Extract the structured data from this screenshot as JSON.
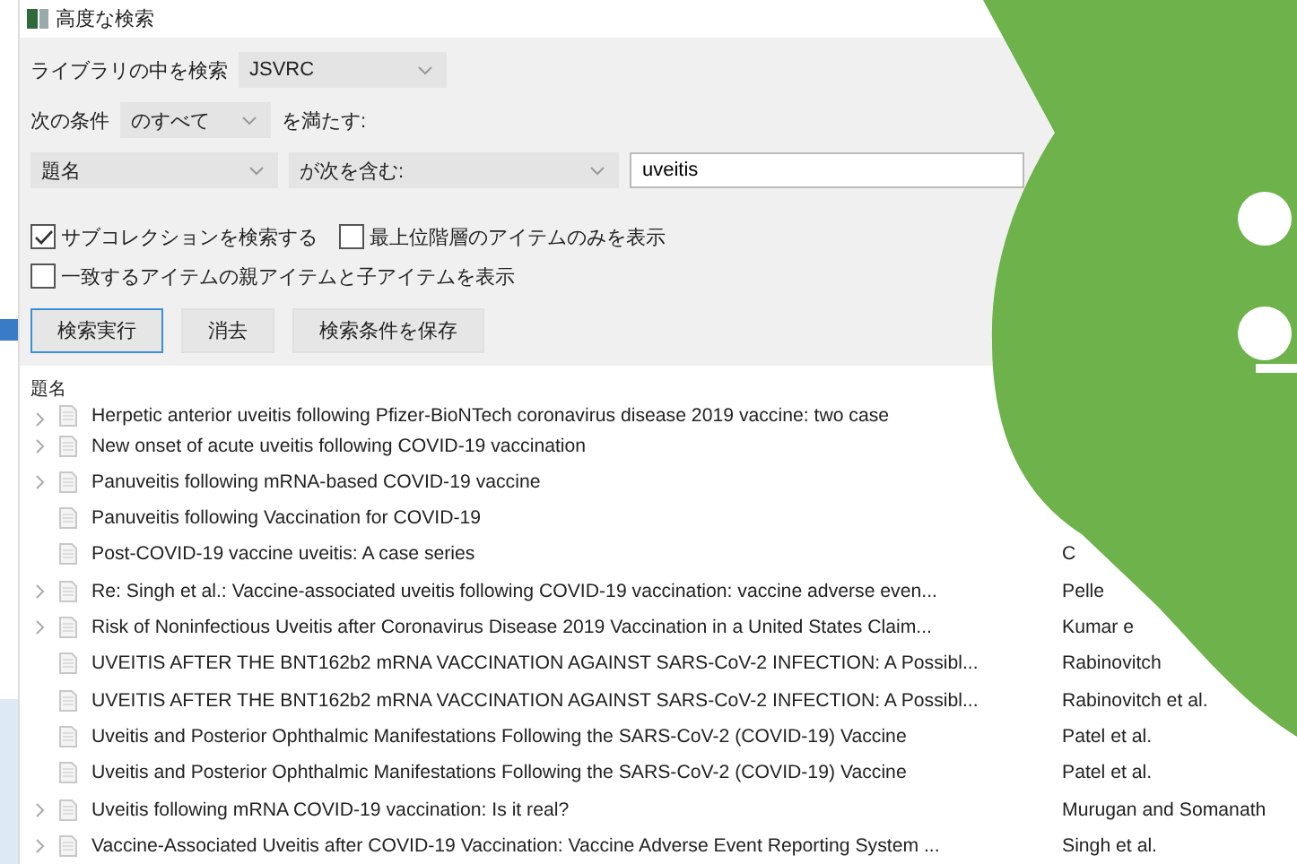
{
  "window": {
    "title": "高度な検索"
  },
  "search_in": {
    "label": "ライブラリの中を検索",
    "value": "JSVRC"
  },
  "match": {
    "label": "次の条件",
    "value": "のすべて",
    "suffix": "を満たす:"
  },
  "condition": {
    "field": "題名",
    "operator": "が次を含む:",
    "value": "uveitis"
  },
  "checkboxes": [
    {
      "label": "サブコレクションを検索する",
      "checked": true
    },
    {
      "label": "最上位階層のアイテムのみを表示",
      "checked": false
    },
    {
      "label": "一致するアイテムの親アイテムと子アイテムを表示",
      "checked": false
    }
  ],
  "buttons": [
    {
      "label": "検索実行",
      "selected": true
    },
    {
      "label": "消去",
      "selected": false
    },
    {
      "label": "検索条件を保存",
      "selected": false
    }
  ],
  "table": {
    "columns": [
      "題名"
    ],
    "rows": [
      {
        "title": "Herpetic anterior uveitis following Pfizer-BioNTech coronavirus disease 2019 vaccine: two case",
        "author": "",
        "expandable": true
      },
      {
        "title": "New onset of acute uveitis following COVID-19 vaccination",
        "author": "",
        "expandable": true
      },
      {
        "title": "Panuveitis following mRNA-based COVID-19 vaccine",
        "author": "",
        "expandable": true
      },
      {
        "title": "Panuveitis following Vaccination for COVID-19",
        "author": "",
        "expandable": false
      },
      {
        "title": "Post-COVID-19 vaccine uveitis: A case series",
        "author": "C",
        "expandable": false
      },
      {
        "title": "Re: Singh et al.: Vaccine-associated uveitis following COVID-19 vaccination: vaccine adverse even...",
        "author": "Pelle",
        "expandable": true
      },
      {
        "title": "Risk of Noninfectious Uveitis after Coronavirus Disease 2019 Vaccination in a United States Claim...",
        "author": "Kumar e",
        "expandable": true
      },
      {
        "title": "UVEITIS AFTER THE BNT162b2 mRNA VACCINATION AGAINST SARS-CoV-2 INFECTION: A Possibl...",
        "author": "Rabinovitch",
        "expandable": false
      },
      {
        "title": "UVEITIS AFTER THE BNT162b2 mRNA VACCINATION AGAINST SARS-CoV-2 INFECTION: A Possibl...",
        "author": "Rabinovitch et al.",
        "expandable": false
      },
      {
        "title": "Uveitis and Posterior Ophthalmic Manifestations Following the SARS-CoV-2 (COVID-19) Vaccine",
        "author": "Patel et al.",
        "expandable": false
      },
      {
        "title": "Uveitis and Posterior Ophthalmic Manifestations Following the SARS-CoV-2 (COVID-19) Vaccine",
        "author": "Patel et al.",
        "expandable": false
      },
      {
        "title": "Uveitis following mRNA COVID-19 vaccination: Is it real?",
        "author": "Murugan and Somanath",
        "expandable": true
      },
      {
        "title": "Vaccine-Associated Uveitis after COVID-19 Vaccination: Vaccine Adverse Event Reporting System ...",
        "author": "Singh et al.",
        "expandable": true
      }
    ]
  }
}
